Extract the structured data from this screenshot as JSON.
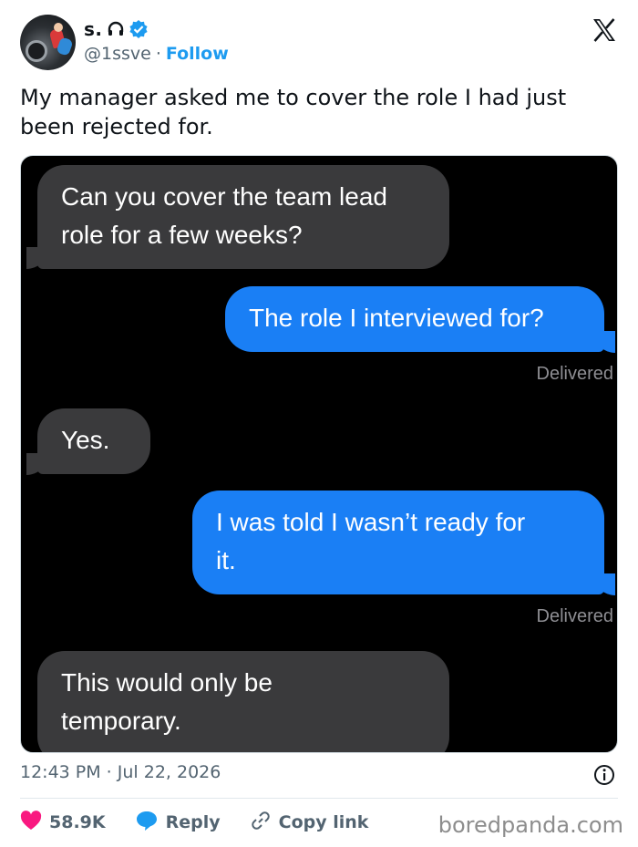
{
  "author": {
    "name": "s.",
    "handle": "@1ssve",
    "separator": "·",
    "follow_label": "Follow"
  },
  "tweet_text": "My manager asked me to cover the role I had just been rejected for.",
  "messages": [
    {
      "side": "in",
      "lines": [
        "Can you cover the team lead",
        "role for a few weeks?"
      ]
    },
    {
      "side": "out",
      "lines": [
        "The role I interviewed for?"
      ],
      "status": "Delivered"
    },
    {
      "side": "in",
      "lines": [
        "Yes."
      ]
    },
    {
      "side": "out",
      "lines": [
        "I was told I wasn’t ready for",
        "it."
      ],
      "status": "Delivered"
    },
    {
      "side": "in",
      "lines": [
        "This would only be",
        "temporary."
      ]
    }
  ],
  "timestamp": "12:43 PM · Jul 22, 2026",
  "actions": {
    "likes": "58.9K",
    "reply_label": "Reply",
    "copy_label": "Copy link"
  },
  "watermark": "boredpanda.com",
  "colors": {
    "bubble_incoming": "#3a3a3c",
    "bubble_outgoing": "#1a7ff5",
    "follow_blue": "#1d9bf0",
    "like_pink": "#f91880"
  },
  "icons": [
    "headphones-icon",
    "verified-badge-icon",
    "x-logo-icon",
    "info-icon",
    "heart-icon",
    "reply-bubble-icon",
    "link-icon"
  ]
}
